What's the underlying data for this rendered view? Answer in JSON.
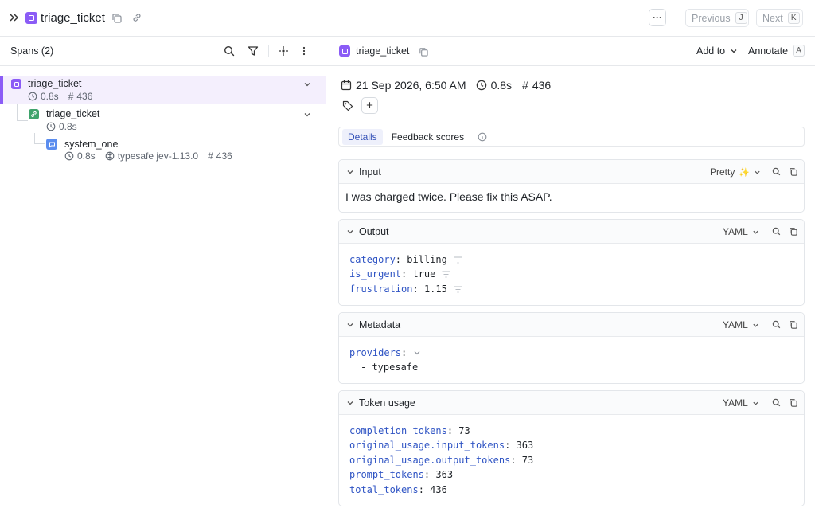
{
  "header": {
    "title": "triage_ticket",
    "previous_label": "Previous",
    "previous_key": "J",
    "next_label": "Next",
    "next_key": "K"
  },
  "sidebar": {
    "title": "Spans (2)",
    "nodes": [
      {
        "name": "triage_ticket",
        "duration": "0.8s",
        "tokens": "436"
      },
      {
        "name": "triage_ticket",
        "duration": "0.8s"
      },
      {
        "name": "system_one",
        "duration": "0.8s",
        "provider": "typesafe jev-1.13.0",
        "tokens": "436"
      }
    ]
  },
  "detail": {
    "title": "triage_ticket",
    "add_to_label": "Add to",
    "annotate_label": "Annotate",
    "annotate_key": "A",
    "timestamp": "21 Sep 2026, 6:50 AM",
    "duration": "0.8s",
    "tokens": "436",
    "tabs": [
      "Details",
      "Feedback scores"
    ],
    "input": {
      "title": "Input",
      "mode": "Pretty",
      "text": "I was charged twice. Please fix this ASAP."
    },
    "output": {
      "title": "Output",
      "mode": "YAML",
      "lines": [
        {
          "key": "category",
          "value": "billing"
        },
        {
          "key": "is_urgent",
          "value": "true"
        },
        {
          "key": "frustration",
          "value": "1.15"
        }
      ]
    },
    "metadata": {
      "title": "Metadata",
      "mode": "YAML",
      "key": "providers",
      "item": "- typesafe"
    },
    "token_usage": {
      "title": "Token usage",
      "mode": "YAML",
      "lines": [
        {
          "key": "completion_tokens",
          "value": "73"
        },
        {
          "key": "original_usage.input_tokens",
          "value": "363"
        },
        {
          "key": "original_usage.output_tokens",
          "value": "73"
        },
        {
          "key": "prompt_tokens",
          "value": "363"
        },
        {
          "key": "total_tokens",
          "value": "436"
        }
      ]
    }
  },
  "colors": {
    "accent_purple": "#8b5cf6",
    "llm_green": "#3fa36b",
    "general_blue": "#5b8def",
    "yaml_key": "#2f54c4",
    "selected_row_bg": "#f4effd"
  }
}
